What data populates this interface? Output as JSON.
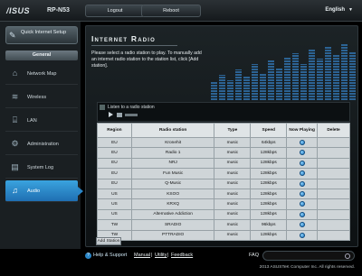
{
  "header": {
    "logo": "/ISUS",
    "model": "RP-N53",
    "logout_label": "Logout",
    "reboot_label": "Reboot",
    "language": "English"
  },
  "sidebar": {
    "quick_setup_label": "Quick Internet Setup",
    "general_label": "General",
    "items": [
      {
        "label": "Network Map"
      },
      {
        "label": "Wireless"
      },
      {
        "label": "LAN"
      },
      {
        "label": "Administration"
      },
      {
        "label": "System Log"
      },
      {
        "label": "Audio"
      }
    ]
  },
  "main": {
    "title": "Internet Radio",
    "description": "Please select a radio station to play. To manually add an internet radio station to the station list, click [Add station].",
    "player_label": "Listen to a radio station",
    "add_station_label": "Add Station"
  },
  "table": {
    "headers": [
      "Region",
      "Radio station",
      "Type",
      "Speed",
      "Now Playing",
      "Delete"
    ],
    "rows": [
      [
        "EU",
        "Kronehit",
        "music",
        "64kbps"
      ],
      [
        "EU",
        "Radio 1",
        "music",
        "128kbps"
      ],
      [
        "EU",
        "NRJ",
        "music",
        "128kbps"
      ],
      [
        "EU",
        "Fun Music",
        "music",
        "128kbps"
      ],
      [
        "EU",
        "Q-Music",
        "music",
        "128kbps"
      ],
      [
        "US",
        "KSOO",
        "music",
        "128kbps"
      ],
      [
        "US",
        "KRXQ",
        "music",
        "128kbps"
      ],
      [
        "US",
        "Alternative Addiction",
        "music",
        "128kbps"
      ],
      [
        "TW",
        "SRADIO",
        "music",
        "96kbps"
      ],
      [
        "TW",
        "PTTRADIO",
        "music",
        "128kbps"
      ]
    ]
  },
  "footer": {
    "help_label": "Help & Support",
    "manual_label": "Manual",
    "utility_label": "Utility",
    "feedback_label": "Feedback",
    "separator": "|",
    "faq_label": "FAQ",
    "copyright": "2013 ASUSTeK Computer Inc. All rights reserved."
  },
  "colors": {
    "accent": "#2a86c8",
    "background": "#000000"
  }
}
